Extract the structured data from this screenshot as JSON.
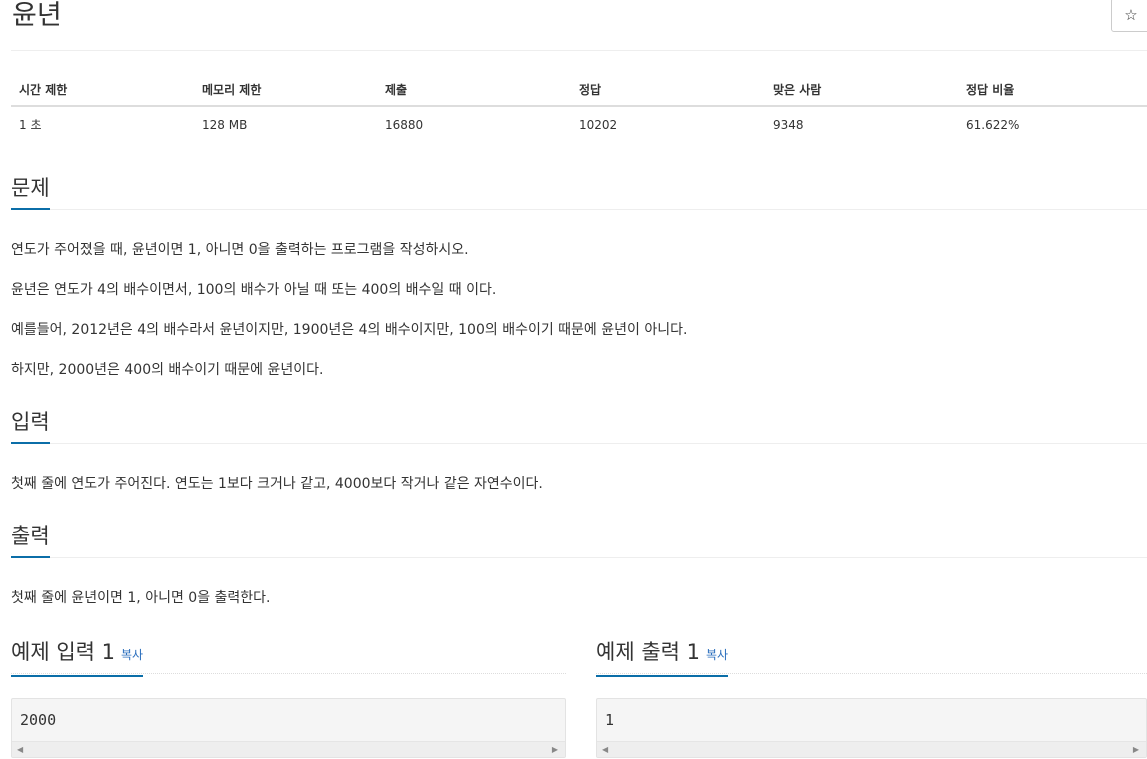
{
  "problem": {
    "title": "윤년",
    "star_label": "☆"
  },
  "info_table": {
    "headers": [
      "시간 제한",
      "메모리 제한",
      "제출",
      "정답",
      "맞은 사람",
      "정답 비율"
    ],
    "values": [
      "1 초",
      "128 MB",
      "16880",
      "10202",
      "9348",
      "61.622%"
    ]
  },
  "sections": {
    "problem": {
      "heading": "문제",
      "paragraphs": [
        "연도가 주어졌을 때, 윤년이면 1, 아니면 0을 출력하는 프로그램을 작성하시오.",
        "윤년은 연도가 4의 배수이면서, 100의 배수가 아닐 때 또는 400의 배수일 때 이다.",
        "예를들어, 2012년은 4의 배수라서 윤년이지만, 1900년은 4의 배수이지만, 100의 배수이기 때문에 윤년이 아니다.",
        "하지만, 2000년은 400의 배수이기 때문에 윤년이다."
      ]
    },
    "input": {
      "heading": "입력",
      "text": "첫째 줄에 연도가 주어진다. 연도는 1보다 크거나 같고, 4000보다 작거나 같은 자연수이다."
    },
    "output": {
      "heading": "출력",
      "text": "첫째 줄에 윤년이면 1, 아니면 0을 출력한다."
    }
  },
  "samples": {
    "input": {
      "heading": "예제 입력 1",
      "copy_label": "복사",
      "content": "2000"
    },
    "output": {
      "heading": "예제 출력 1",
      "copy_label": "복사",
      "content": "1"
    }
  },
  "icons": {
    "scroll_left": "◀",
    "scroll_right": "▶"
  }
}
